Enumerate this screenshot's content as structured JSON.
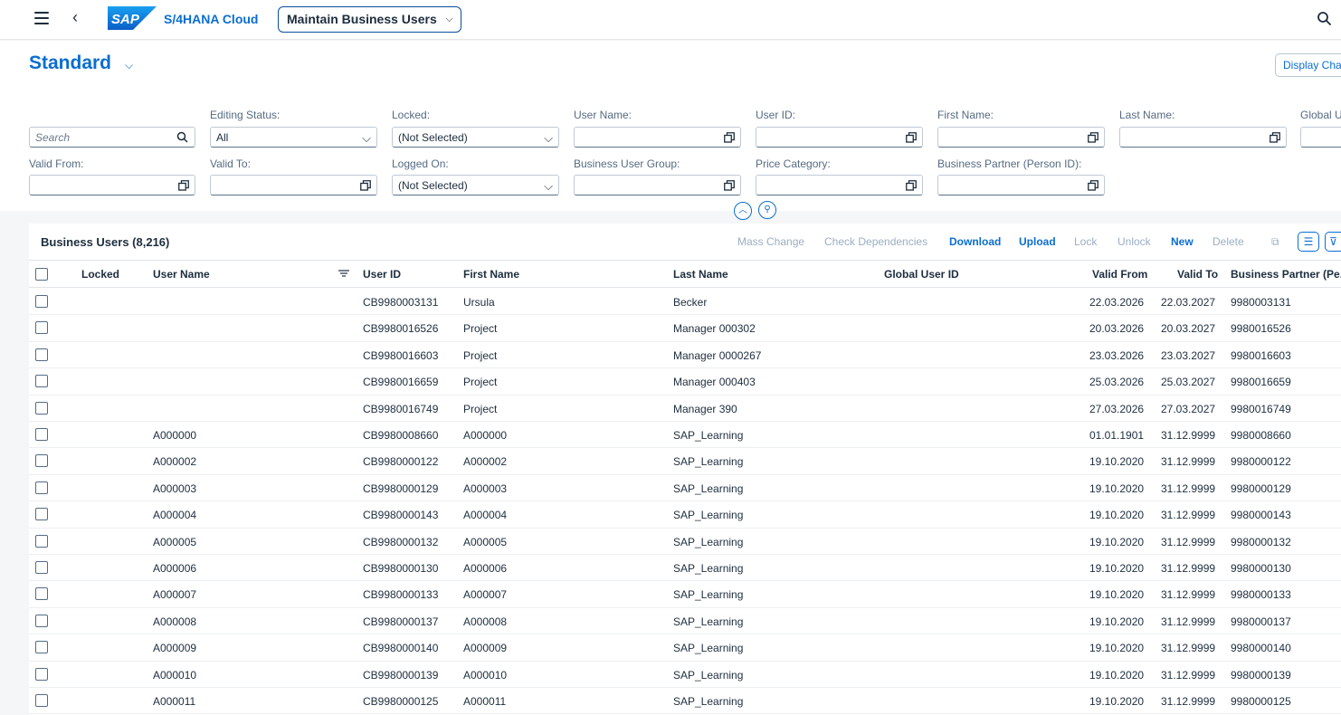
{
  "shell": {
    "product": "S/4HANA Cloud",
    "logo_text": "SAP",
    "app_title": "Maintain Business Users"
  },
  "variant": {
    "title": "Standard",
    "display_button": "Display Cha"
  },
  "filters": {
    "search_placeholder": "Search",
    "editing_status": {
      "label": "Editing Status:",
      "value": "All"
    },
    "locked": {
      "label": "Locked:",
      "value": "(Not Selected)"
    },
    "user_name": {
      "label": "User Name:",
      "value": ""
    },
    "user_id": {
      "label": "User ID:",
      "value": ""
    },
    "first_name": {
      "label": "First Name:",
      "value": ""
    },
    "last_name": {
      "label": "Last Name:",
      "value": ""
    },
    "global_user": {
      "label": "Global U",
      "value": ""
    },
    "valid_from": {
      "label": "Valid From:",
      "value": ""
    },
    "valid_to": {
      "label": "Valid To:",
      "value": ""
    },
    "logged_on": {
      "label": "Logged On:",
      "value": "(Not Selected)"
    },
    "business_user_group": {
      "label": "Business User Group:",
      "value": ""
    },
    "price_category": {
      "label": "Price Category:",
      "value": ""
    },
    "business_partner": {
      "label": "Business Partner (Person ID):",
      "value": ""
    }
  },
  "table": {
    "title": "Business Users (8,216)",
    "toolbar": {
      "mass_change": "Mass Change",
      "check_dependencies": "Check Dependencies",
      "download": "Download",
      "upload": "Upload",
      "lock": "Lock",
      "unlock": "Unlock",
      "new": "New",
      "delete": "Delete"
    },
    "columns": {
      "locked": "Locked",
      "user_name": "User Name",
      "user_id": "User ID",
      "first_name": "First Name",
      "last_name": "Last Name",
      "global_user_id": "Global User ID",
      "valid_from": "Valid From",
      "valid_to": "Valid To",
      "business_partner": "Business Partner (Pe..."
    },
    "rows": [
      {
        "locked": "",
        "user_name": "",
        "user_id": "CB9980003131",
        "first_name": "Ursula",
        "last_name": "Becker",
        "global_user_id": "",
        "valid_from": "22.03.2026",
        "valid_to": "22.03.2027",
        "bp": "9980003131"
      },
      {
        "locked": "",
        "user_name": "",
        "user_id": "CB9980016526",
        "first_name": "Project",
        "last_name": "Manager 000302",
        "global_user_id": "",
        "valid_from": "20.03.2026",
        "valid_to": "20.03.2027",
        "bp": "9980016526"
      },
      {
        "locked": "",
        "user_name": "",
        "user_id": "CB9980016603",
        "first_name": "Project",
        "last_name": "Manager 0000267",
        "global_user_id": "",
        "valid_from": "23.03.2026",
        "valid_to": "23.03.2027",
        "bp": "9980016603"
      },
      {
        "locked": "",
        "user_name": "",
        "user_id": "CB9980016659",
        "first_name": "Project",
        "last_name": "Manager 000403",
        "global_user_id": "",
        "valid_from": "25.03.2026",
        "valid_to": "25.03.2027",
        "bp": "9980016659"
      },
      {
        "locked": "",
        "user_name": "",
        "user_id": "CB9980016749",
        "first_name": "Project",
        "last_name": "Manager 390",
        "global_user_id": "",
        "valid_from": "27.03.2026",
        "valid_to": "27.03.2027",
        "bp": "9980016749"
      },
      {
        "locked": "",
        "user_name": "A000000",
        "user_id": "CB9980008660",
        "first_name": "A000000",
        "last_name": "SAP_Learning",
        "global_user_id": "",
        "valid_from": "01.01.1901",
        "valid_to": "31.12.9999",
        "bp": "9980008660"
      },
      {
        "locked": "",
        "user_name": "A000002",
        "user_id": "CB9980000122",
        "first_name": "A000002",
        "last_name": "SAP_Learning",
        "global_user_id": "",
        "valid_from": "19.10.2020",
        "valid_to": "31.12.9999",
        "bp": "9980000122"
      },
      {
        "locked": "",
        "user_name": "A000003",
        "user_id": "CB9980000129",
        "first_name": "A000003",
        "last_name": "SAP_Learning",
        "global_user_id": "",
        "valid_from": "19.10.2020",
        "valid_to": "31.12.9999",
        "bp": "9980000129"
      },
      {
        "locked": "",
        "user_name": "A000004",
        "user_id": "CB9980000143",
        "first_name": "A000004",
        "last_name": "SAP_Learning",
        "global_user_id": "",
        "valid_from": "19.10.2020",
        "valid_to": "31.12.9999",
        "bp": "9980000143"
      },
      {
        "locked": "",
        "user_name": "A000005",
        "user_id": "CB9980000132",
        "first_name": "A000005",
        "last_name": "SAP_Learning",
        "global_user_id": "",
        "valid_from": "19.10.2020",
        "valid_to": "31.12.9999",
        "bp": "9980000132"
      },
      {
        "locked": "",
        "user_name": "A000006",
        "user_id": "CB9980000130",
        "first_name": "A000006",
        "last_name": "SAP_Learning",
        "global_user_id": "",
        "valid_from": "19.10.2020",
        "valid_to": "31.12.9999",
        "bp": "9980000130"
      },
      {
        "locked": "",
        "user_name": "A000007",
        "user_id": "CB9980000133",
        "first_name": "A000007",
        "last_name": "SAP_Learning",
        "global_user_id": "",
        "valid_from": "19.10.2020",
        "valid_to": "31.12.9999",
        "bp": "9980000133"
      },
      {
        "locked": "",
        "user_name": "A000008",
        "user_id": "CB9980000137",
        "first_name": "A000008",
        "last_name": "SAP_Learning",
        "global_user_id": "",
        "valid_from": "19.10.2020",
        "valid_to": "31.12.9999",
        "bp": "9980000137"
      },
      {
        "locked": "",
        "user_name": "A000009",
        "user_id": "CB9980000140",
        "first_name": "A000009",
        "last_name": "SAP_Learning",
        "global_user_id": "",
        "valid_from": "19.10.2020",
        "valid_to": "31.12.9999",
        "bp": "9980000140"
      },
      {
        "locked": "",
        "user_name": "A000010",
        "user_id": "CB9980000139",
        "first_name": "A000010",
        "last_name": "SAP_Learning",
        "global_user_id": "",
        "valid_from": "19.10.2020",
        "valid_to": "31.12.9999",
        "bp": "9980000139"
      },
      {
        "locked": "",
        "user_name": "A000011",
        "user_id": "CB9980000125",
        "first_name": "A000011",
        "last_name": "SAP_Learning",
        "global_user_id": "",
        "valid_from": "19.10.2020",
        "valid_to": "31.12.9999",
        "bp": "9980000125"
      }
    ]
  },
  "colors": {
    "accent": "#0a6ed1",
    "text": "#1d2d3e",
    "disabled": "#9aaec4",
    "background": "#f5f6f7"
  },
  "icons": [
    "menu-icon",
    "back-icon",
    "search-icon",
    "chevron-down-icon",
    "value-help-icon",
    "collapse-icon",
    "pin-icon",
    "sort-icon",
    "settings-icon",
    "filter-icon"
  ]
}
